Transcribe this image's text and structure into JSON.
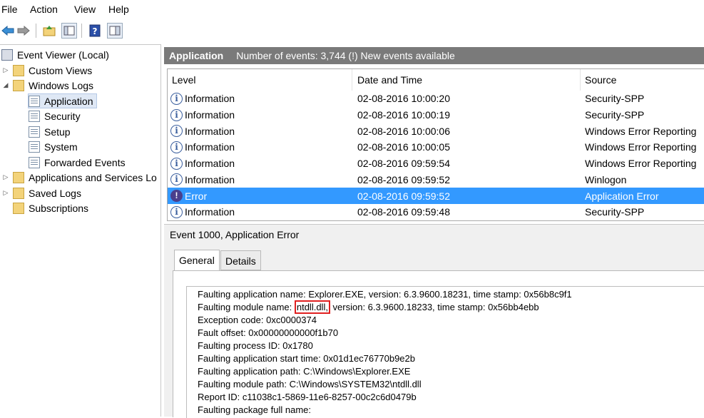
{
  "menu": {
    "file": "File",
    "action": "Action",
    "view": "View",
    "help": "Help"
  },
  "toolbar": {
    "back": "back-arrow-icon",
    "forward": "forward-arrow-icon",
    "up": "up-folder-icon",
    "show_hide": "show-hide-tree-icon",
    "help": "help-icon",
    "properties": "properties-icon"
  },
  "tree": {
    "root": "Event Viewer (Local)",
    "custom_views": "Custom Views",
    "windows_logs": "Windows Logs",
    "application": "Application",
    "security": "Security",
    "setup": "Setup",
    "system": "System",
    "forwarded": "Forwarded Events",
    "apps_services": "Applications and Services Lo",
    "saved_logs": "Saved Logs",
    "subscriptions": "Subscriptions"
  },
  "header": {
    "title": "Application",
    "summary": "Number of events: 3,744 (!) New events available"
  },
  "columns": {
    "level": "Level",
    "datetime": "Date and Time",
    "source": "Source"
  },
  "events": [
    {
      "level": "Information",
      "datetime": "02-08-2016 10:00:20",
      "source": "Security-SPP"
    },
    {
      "level": "Information",
      "datetime": "02-08-2016 10:00:19",
      "source": "Security-SPP"
    },
    {
      "level": "Information",
      "datetime": "02-08-2016 10:00:06",
      "source": "Windows Error Reporting"
    },
    {
      "level": "Information",
      "datetime": "02-08-2016 10:00:05",
      "source": "Windows Error Reporting"
    },
    {
      "level": "Information",
      "datetime": "02-08-2016 09:59:54",
      "source": "Windows Error Reporting"
    },
    {
      "level": "Information",
      "datetime": "02-08-2016 09:59:52",
      "source": "Winlogon"
    },
    {
      "level": "Error",
      "datetime": "02-08-2016 09:59:52",
      "source": "Application Error"
    },
    {
      "level": "Information",
      "datetime": "02-08-2016 09:59:48",
      "source": "Security-SPP"
    }
  ],
  "details": {
    "title": "Event 1000, Application Error",
    "tab_general": "General",
    "tab_details": "Details",
    "line1": "Faulting application name: Explorer.EXE, version: 6.3.9600.18231, time stamp: 0x56b8c9f1",
    "line2_prefix": "Faulting module name: ",
    "line2_highlight": "ntdll.dll,",
    "line2_suffix": " version: 6.3.9600.18233, time stamp: 0x56bb4ebb",
    "line3": "Exception code: 0xc0000374",
    "line4": "Fault offset: 0x00000000000f1b70",
    "line5": "Faulting process ID: 0x1780",
    "line6": "Faulting application start time: 0x01d1ec76770b9e2b",
    "line7": "Faulting application path: C:\\Windows\\Explorer.EXE",
    "line8": "Faulting module path: C:\\Windows\\SYSTEM32\\ntdll.dll",
    "line9": "Report ID: c11038c1-5869-11e6-8257-00c2c6d0479b",
    "line10": "Faulting package full name:"
  },
  "colors": {
    "selection": "#3399ff",
    "header_bg": "#7a7a7a",
    "highlight_box": "#e02020"
  }
}
